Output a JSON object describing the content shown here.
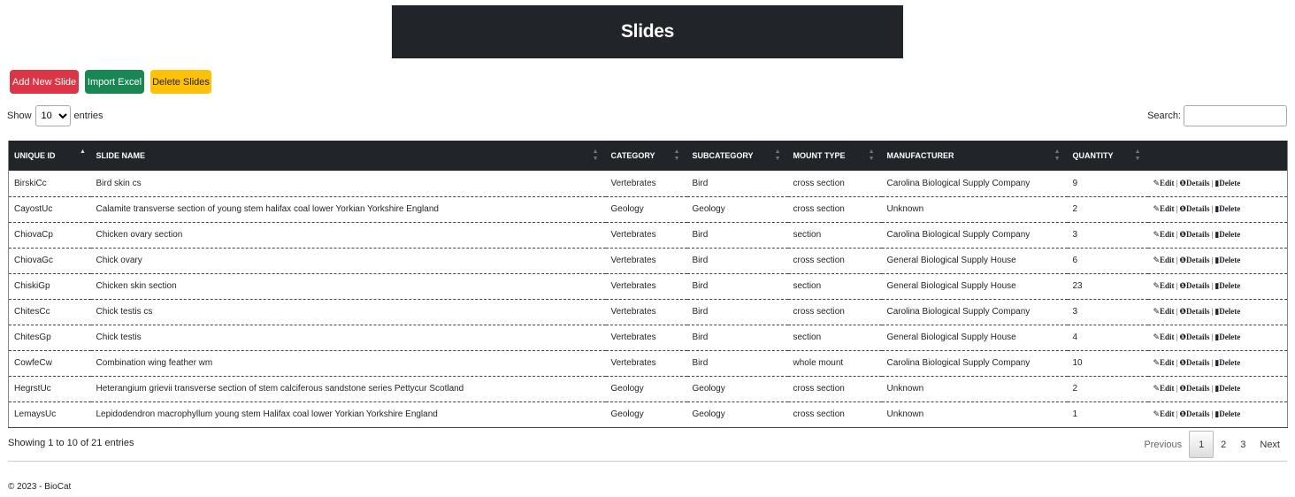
{
  "header": {
    "title": "Slides"
  },
  "toolbar": {
    "add_label": "Add New Slide",
    "import_label": "Import Excel",
    "delete_label": "Delete Slides"
  },
  "length": {
    "show": "Show",
    "value": "10",
    "entries": "entries"
  },
  "search": {
    "label": "Search:"
  },
  "table": {
    "columns": [
      "Unique ID",
      "Slide Name",
      "Category",
      "Subcategory",
      "Mount Type",
      "Manufacturer",
      "Quantity",
      ""
    ],
    "rows": [
      [
        "BirskiCc",
        "Bird skin cs",
        "Vertebrates",
        "Bird",
        "cross section",
        "Carolina Biological Supply Company",
        "9"
      ],
      [
        "CayostUc",
        "Calamite transverse section of young stem halifax coal lower Yorkian Yorkshire England",
        "Geology",
        "Geology",
        "cross section",
        "Unknown",
        "2"
      ],
      [
        "ChiovaCp",
        "Chicken ovary section",
        "Vertebrates",
        "Bird",
        "section",
        "Carolina Biological Supply Company",
        "3"
      ],
      [
        "ChiovaGc",
        "Chick ovary",
        "Vertebrates",
        "Bird",
        "cross section",
        "General Biological Supply House",
        "6"
      ],
      [
        "ChiskiGp",
        "Chicken skin section",
        "Vertebrates",
        "Bird",
        "section",
        "General Biological Supply House",
        "23"
      ],
      [
        "ChitesCc",
        "Chick testis cs",
        "Vertebrates",
        "Bird",
        "cross section",
        "Carolina Biological Supply Company",
        "3"
      ],
      [
        "ChitesGp",
        "Chick testis",
        "Vertebrates",
        "Bird",
        "section",
        "General Biological Supply House",
        "4"
      ],
      [
        "CowfeCw",
        "Combination wing feather wm",
        "Vertebrates",
        "Bird",
        "whole mount",
        "Carolina Biological Supply Company",
        "10"
      ],
      [
        "HegrstUc",
        "Heterangium grievii transverse section of stem calciferous sandstone series Pettycur Scotland",
        "Geology",
        "Geology",
        "cross section",
        "Unknown",
        "2"
      ],
      [
        "LemaysUc",
        "Lepidodendron macrophyllum young stem Halifax coal lower Yorkian Yorkshire England",
        "Geology",
        "Geology",
        "cross section",
        "Unknown",
        "1"
      ]
    ],
    "actions": {
      "edit": "Edit",
      "details": "Details",
      "delete": "Delete",
      "sep": "|"
    }
  },
  "info": "Showing 1 to 10 of 21 entries",
  "pager": {
    "previous": "Previous",
    "pages": [
      "1",
      "2",
      "3"
    ],
    "next": "Next"
  },
  "footer": "© 2023 - BioCat",
  "colors": {
    "danger": "#dc3545",
    "success": "#198754",
    "warning": "#ffc107",
    "dark": "#212529"
  }
}
